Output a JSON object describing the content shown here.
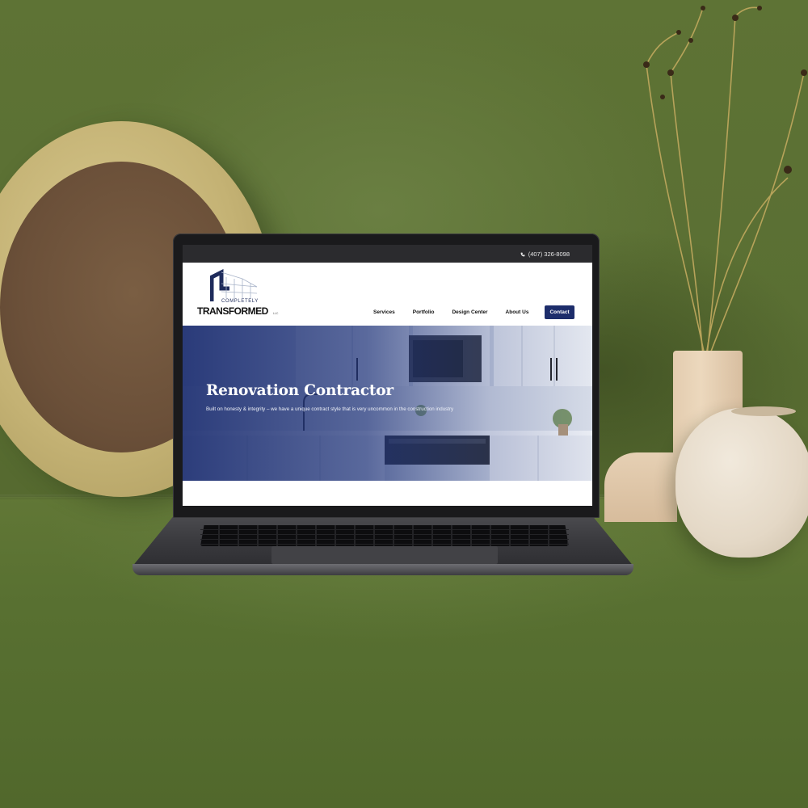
{
  "topbar": {
    "phone": "(407) 326-8098"
  },
  "logo": {
    "line1": "COMPLETELY",
    "line2": "TRANSFORMED",
    "suffix": "LLC"
  },
  "nav": {
    "items": [
      "Services",
      "Portfolio",
      "Design Center",
      "About Us"
    ],
    "contact": "Contact"
  },
  "hero": {
    "title": "Renovation Contractor",
    "subtitle": "Built on honesty & integrity – we have a unique contract style that is very uncommon in the construction industry"
  },
  "colors": {
    "brand_navy": "#1d2d6b",
    "topbar": "#2b2b2e",
    "background_green": "#5d7236"
  },
  "icons": [
    "phone-icon",
    "logo-house-icon"
  ]
}
